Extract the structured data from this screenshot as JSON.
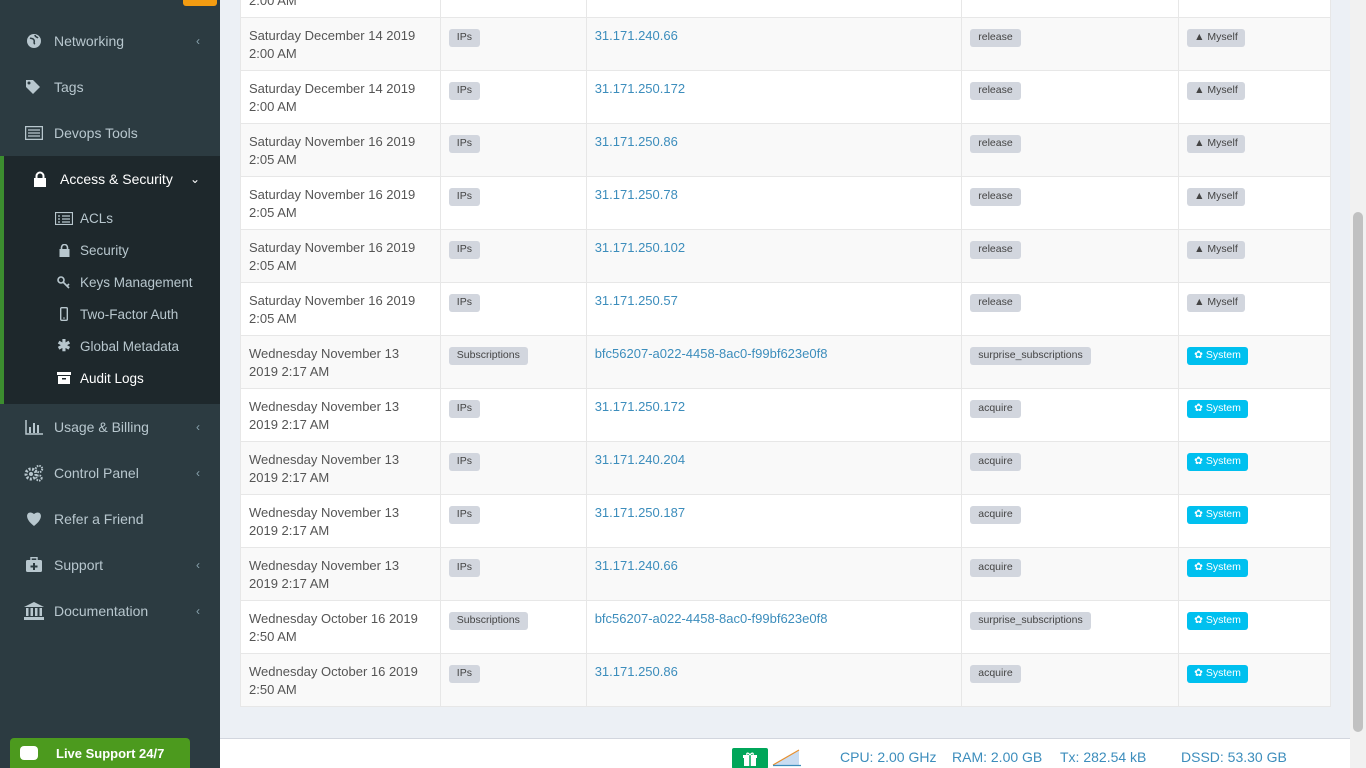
{
  "sidebar": {
    "items": [
      {
        "label": "Networking",
        "icon": "globe-icon",
        "chevron": "‹"
      },
      {
        "label": "Tags",
        "icon": "tags-icon",
        "chevron": ""
      },
      {
        "label": "Devops Tools",
        "icon": "terminal-icon",
        "chevron": ""
      },
      {
        "label": "Access & Security",
        "icon": "lock-icon",
        "chevron": "⌄"
      },
      {
        "label": "Usage & Billing",
        "icon": "bar-chart-icon",
        "chevron": "‹"
      },
      {
        "label": "Control Panel",
        "icon": "gears-icon",
        "chevron": "‹"
      },
      {
        "label": "Refer a Friend",
        "icon": "heart-icon",
        "chevron": ""
      },
      {
        "label": "Support",
        "icon": "medkit-icon",
        "chevron": "‹"
      },
      {
        "label": "Documentation",
        "icon": "bank-icon",
        "chevron": "‹"
      }
    ],
    "submenu": [
      {
        "label": "ACLs",
        "icon": "list-icon"
      },
      {
        "label": "Security",
        "icon": "padlock-icon"
      },
      {
        "label": "Keys Management",
        "icon": "key-icon"
      },
      {
        "label": "Two-Factor Auth",
        "icon": "mobile-icon"
      },
      {
        "label": "Global Metadata",
        "icon": "asterisk-icon"
      },
      {
        "label": "Audit Logs",
        "icon": "archive-icon"
      }
    ]
  },
  "table": {
    "top_partial_date": "2:00 AM",
    "rows": [
      {
        "date": "Saturday December 14 2019",
        "time": "2:00 AM",
        "type": "IPs",
        "resource": "31.171.240.66",
        "action": "release",
        "actor": "Myself",
        "actor_kind": "user"
      },
      {
        "date": "Saturday December 14 2019",
        "time": "2:00 AM",
        "type": "IPs",
        "resource": "31.171.250.172",
        "action": "release",
        "actor": "Myself",
        "actor_kind": "user"
      },
      {
        "date": "Saturday November 16 2019",
        "time": "2:05 AM",
        "type": "IPs",
        "resource": "31.171.250.86",
        "action": "release",
        "actor": "Myself",
        "actor_kind": "user"
      },
      {
        "date": "Saturday November 16 2019",
        "time": "2:05 AM",
        "type": "IPs",
        "resource": "31.171.250.78",
        "action": "release",
        "actor": "Myself",
        "actor_kind": "user"
      },
      {
        "date": "Saturday November 16 2019",
        "time": "2:05 AM",
        "type": "IPs",
        "resource": "31.171.250.102",
        "action": "release",
        "actor": "Myself",
        "actor_kind": "user"
      },
      {
        "date": "Saturday November 16 2019",
        "time": "2:05 AM",
        "type": "IPs",
        "resource": "31.171.250.57",
        "action": "release",
        "actor": "Myself",
        "actor_kind": "user"
      },
      {
        "date": "Wednesday November 13",
        "time": "2019 2:17 AM",
        "type": "Subscriptions",
        "resource": "bfc56207-a022-4458-8ac0-f99bf623e0f8",
        "action": "surprise_subscriptions",
        "actor": "System",
        "actor_kind": "system"
      },
      {
        "date": "Wednesday November 13",
        "time": "2019 2:17 AM",
        "type": "IPs",
        "resource": "31.171.250.172",
        "action": "acquire",
        "actor": "System",
        "actor_kind": "system"
      },
      {
        "date": "Wednesday November 13",
        "time": "2019 2:17 AM",
        "type": "IPs",
        "resource": "31.171.240.204",
        "action": "acquire",
        "actor": "System",
        "actor_kind": "system"
      },
      {
        "date": "Wednesday November 13",
        "time": "2019 2:17 AM",
        "type": "IPs",
        "resource": "31.171.250.187",
        "action": "acquire",
        "actor": "System",
        "actor_kind": "system"
      },
      {
        "date": "Wednesday November 13",
        "time": "2019 2:17 AM",
        "type": "IPs",
        "resource": "31.171.240.66",
        "action": "acquire",
        "actor": "System",
        "actor_kind": "system"
      },
      {
        "date": "Wednesday October 16 2019",
        "time": "2:50 AM",
        "type": "Subscriptions",
        "resource": "bfc56207-a022-4458-8ac0-f99bf623e0f8",
        "action": "surprise_subscriptions",
        "actor": "System",
        "actor_kind": "system"
      },
      {
        "date": "Wednesday October 16 2019",
        "time": "2:50 AM",
        "type": "IPs",
        "resource": "31.171.250.86",
        "action": "acquire",
        "actor": "System",
        "actor_kind": "system"
      }
    ]
  },
  "footer": {
    "cpu": "CPU: 2.00 GHz",
    "ram": "RAM: 2.00 GB",
    "tx": "Tx: 282.54 kB",
    "dssd": "DSSD: 53.30 GB"
  },
  "live_support": {
    "label": "Live Support 24/7"
  },
  "colors": {
    "accent": "#3c8dbc",
    "sidebar": "#2c3b41",
    "system_badge": "#00c0ef",
    "live": "#4c9a1e"
  }
}
